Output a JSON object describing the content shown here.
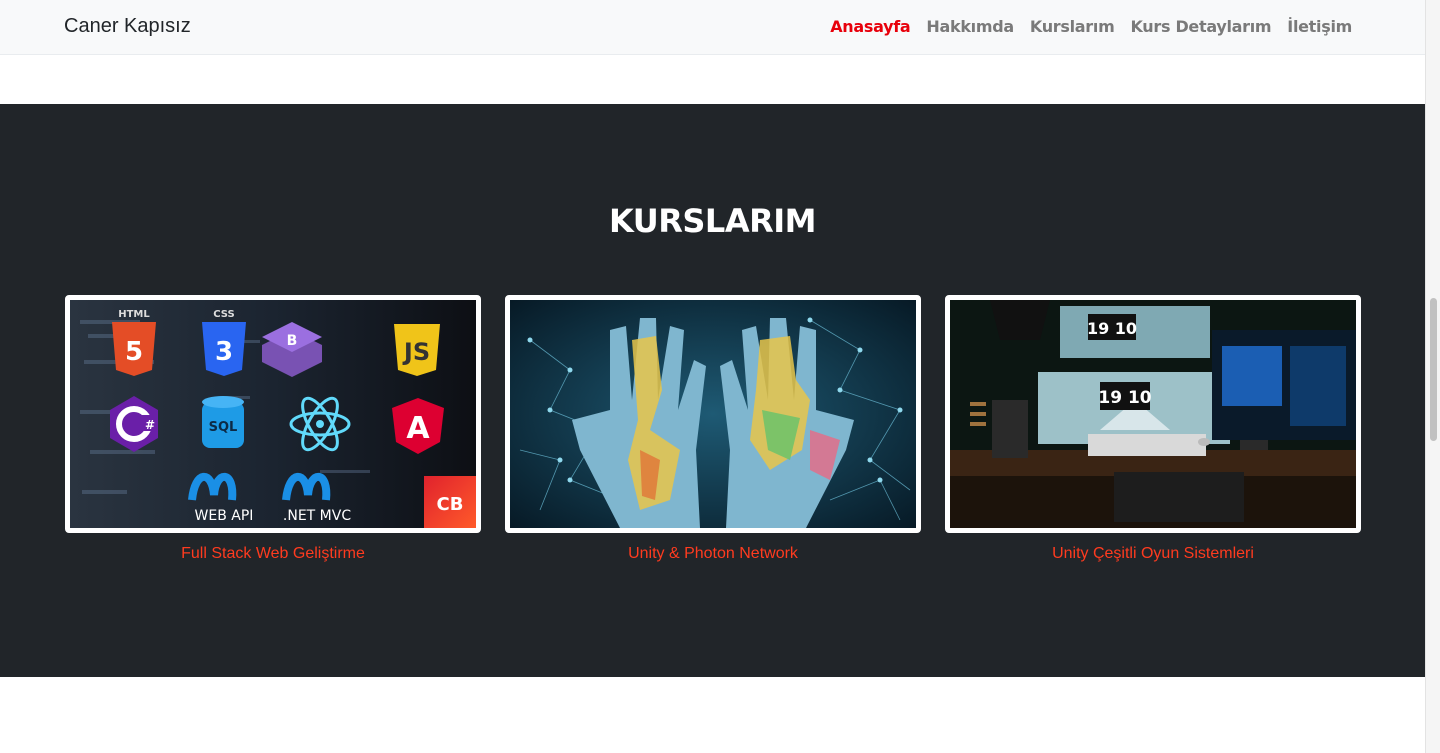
{
  "navbar": {
    "brand": "Caner Kapısız",
    "items": [
      {
        "label": "Anasayfa",
        "active": true
      },
      {
        "label": "Hakkımda",
        "active": false
      },
      {
        "label": "Kurslarım",
        "active": false
      },
      {
        "label": "Kurs Detaylarım",
        "active": false
      },
      {
        "label": "İletişim",
        "active": false
      }
    ]
  },
  "courses": {
    "heading": "KURSLARIM",
    "cards": [
      {
        "title": "Full Stack Web Geliştirme",
        "image_labels": {
          "html": "HTML",
          "css": "CSS",
          "js": "JS",
          "sql": "SQL",
          "webapi": "WEB API",
          "netmvc": ".NET MVC",
          "logo": "CB"
        }
      },
      {
        "title": "Unity & Photon Network"
      },
      {
        "title": "Unity Çeşitli Oyun Sistemleri",
        "image_labels": {
          "clock_top": "19 10",
          "clock_bottom": "19 10"
        }
      }
    ]
  },
  "colors": {
    "navbar_bg": "#f8f9fa",
    "active_link": "#e8000b",
    "link": "#7a7a7a",
    "section_bg": "#212529",
    "card_title": "#ff3b1f"
  }
}
